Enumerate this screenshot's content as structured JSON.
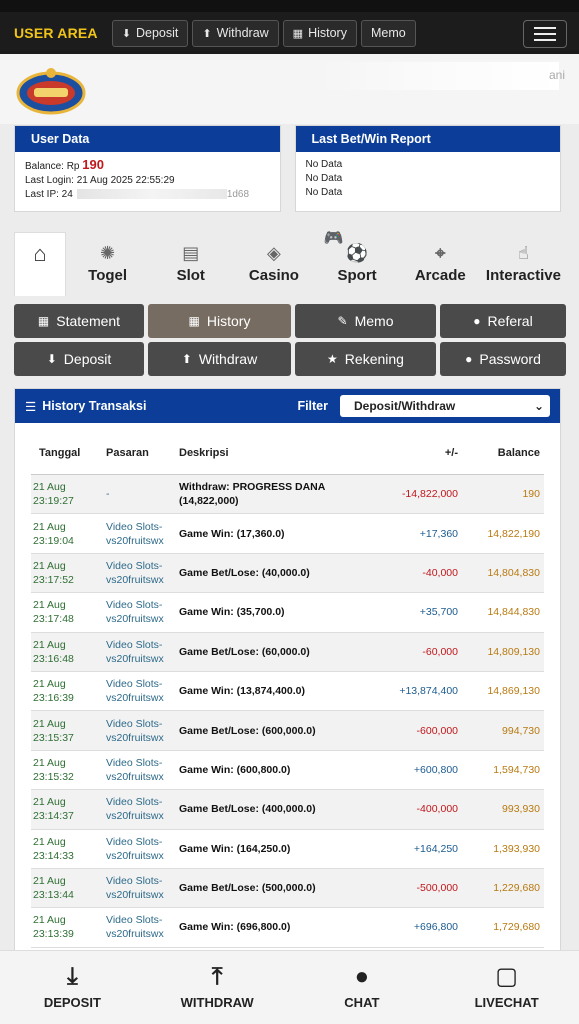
{
  "topnav": {
    "brand": "USER AREA",
    "buttons": [
      {
        "label": "Deposit",
        "icon": "deposit-icon"
      },
      {
        "label": "Withdraw",
        "icon": "withdraw-icon"
      },
      {
        "label": "History",
        "icon": "history-icon"
      },
      {
        "label": "Memo",
        "icon": ""
      }
    ]
  },
  "header": {
    "username_suffix": "ani"
  },
  "user_data": {
    "title": "User Data",
    "balance_label": "Balance: Rp ",
    "balance_value": "190",
    "last_login": "Last Login: 21 Aug 2025 22:55:29",
    "last_ip_label": "Last IP: 24",
    "last_ip_suffix": "1d68"
  },
  "report": {
    "title": "Last Bet/Win Report",
    "lines": [
      "No Data",
      "No Data",
      "No Data"
    ]
  },
  "game_tabs": [
    {
      "label": "",
      "icon": "home-icon"
    },
    {
      "label": "Togel",
      "icon": "lottery-icon"
    },
    {
      "label": "Slot",
      "icon": "slot-machine-icon"
    },
    {
      "label": "Casino",
      "icon": "casino-chip-icon"
    },
    {
      "label": "Sport",
      "icon": "soccer-ball-icon"
    },
    {
      "label": "Arcade",
      "icon": "crosshair-icon"
    },
    {
      "label": "Interactive",
      "icon": "touch-hand-icon"
    }
  ],
  "actions": [
    {
      "label": "Statement",
      "icon": "calendar-icon"
    },
    {
      "label": "History",
      "icon": "calendar-icon"
    },
    {
      "label": "Memo",
      "icon": "edit-icon"
    },
    {
      "label": "Referal",
      "icon": "user-icon"
    },
    {
      "label": "Deposit",
      "icon": "deposit-icon"
    },
    {
      "label": "Withdraw",
      "icon": "withdraw-icon"
    },
    {
      "label": "Rekening",
      "icon": "bank-icon"
    },
    {
      "label": "Password",
      "icon": "user-icon"
    }
  ],
  "history": {
    "title": "History Transaksi",
    "filter_label": "Filter",
    "filter_value": "Deposit/Withdraw",
    "columns": [
      "Tanggal",
      "Pasaran",
      "Deskripsi",
      "+/-",
      "Balance"
    ],
    "rows": [
      {
        "date": "21 Aug",
        "time": "23:19:27",
        "market1": "-",
        "market2": "",
        "desc": "Withdraw: PROGRESS DANA (14,822,000)",
        "amount": "-14,822,000",
        "sign": "neg",
        "balance": "190"
      },
      {
        "date": "21 Aug",
        "time": "23:19:04",
        "market1": "Video Slots-",
        "market2": "vs20fruitswx",
        "desc": "Game Win: (17,360.0)",
        "amount": "+17,360",
        "sign": "pos",
        "balance": "14,822,190"
      },
      {
        "date": "21 Aug",
        "time": "23:17:52",
        "market1": "Video Slots-",
        "market2": "vs20fruitswx",
        "desc": "Game Bet/Lose: (40,000.0)",
        "amount": "-40,000",
        "sign": "neg",
        "balance": "14,804,830"
      },
      {
        "date": "21 Aug",
        "time": "23:17:48",
        "market1": "Video Slots-",
        "market2": "vs20fruitswx",
        "desc": "Game Win: (35,700.0)",
        "amount": "+35,700",
        "sign": "pos",
        "balance": "14,844,830"
      },
      {
        "date": "21 Aug",
        "time": "23:16:48",
        "market1": "Video Slots-",
        "market2": "vs20fruitswx",
        "desc": "Game Bet/Lose: (60,000.0)",
        "amount": "-60,000",
        "sign": "neg",
        "balance": "14,809,130"
      },
      {
        "date": "21 Aug",
        "time": "23:16:39",
        "market1": "Video Slots-",
        "market2": "vs20fruitswx",
        "desc": "Game Win: (13,874,400.0)",
        "amount": "+13,874,400",
        "sign": "pos",
        "balance": "14,869,130"
      },
      {
        "date": "21 Aug",
        "time": "23:15:37",
        "market1": "Video Slots-",
        "market2": "vs20fruitswx",
        "desc": "Game Bet/Lose: (600,000.0)",
        "amount": "-600,000",
        "sign": "neg",
        "balance": "994,730"
      },
      {
        "date": "21 Aug",
        "time": "23:15:32",
        "market1": "Video Slots-",
        "market2": "vs20fruitswx",
        "desc": "Game Win: (600,800.0)",
        "amount": "+600,800",
        "sign": "pos",
        "balance": "1,594,730"
      },
      {
        "date": "21 Aug",
        "time": "23:14:37",
        "market1": "Video Slots-",
        "market2": "vs20fruitswx",
        "desc": "Game Bet/Lose: (400,000.0)",
        "amount": "-400,000",
        "sign": "neg",
        "balance": "993,930"
      },
      {
        "date": "21 Aug",
        "time": "23:14:33",
        "market1": "Video Slots-",
        "market2": "vs20fruitswx",
        "desc": "Game Win: (164,250.0)",
        "amount": "+164,250",
        "sign": "pos",
        "balance": "1,393,930"
      },
      {
        "date": "21 Aug",
        "time": "23:13:44",
        "market1": "Video Slots-",
        "market2": "vs20fruitswx",
        "desc": "Game Bet/Lose: (500,000.0)",
        "amount": "-500,000",
        "sign": "neg",
        "balance": "1,229,680"
      },
      {
        "date": "21 Aug",
        "time": "23:13:39",
        "market1": "Video Slots-",
        "market2": "vs20fruitswx",
        "desc": "Game Win: (696,800.0)",
        "amount": "+696,800",
        "sign": "pos",
        "balance": "1,729,680"
      }
    ]
  },
  "bottom_nav": [
    {
      "label": "DEPOSIT",
      "icon": "download-tray-icon"
    },
    {
      "label": "WITHDRAW",
      "icon": "upload-tray-icon"
    },
    {
      "label": "CHAT",
      "icon": "chat-bubble-icon"
    },
    {
      "label": "LIVECHAT",
      "icon": "livechat-bubble-icon"
    }
  ],
  "colors": {
    "brand_yellow": "#f0c419",
    "panel_blue": "#0b3d99",
    "negative_red": "#c0171b",
    "positive_blue": "#1c5b8f",
    "balance_gold": "#b87a10",
    "date_green": "#2f6f33"
  }
}
